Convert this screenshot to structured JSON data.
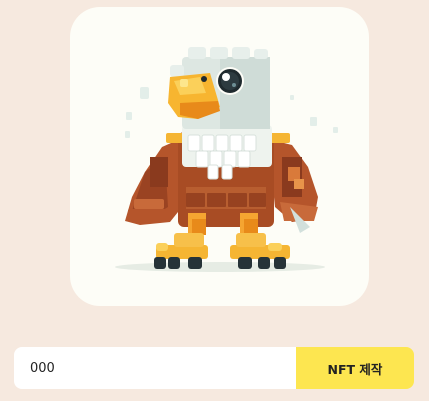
{
  "preview": {
    "subject": "lego-style-eagle-illustration"
  },
  "form": {
    "name_value": "000",
    "mint_button_label": "NFT 제작"
  },
  "colors": {
    "background": "#f6e9df",
    "card": "#fdfdf7",
    "button": "#fde650"
  }
}
